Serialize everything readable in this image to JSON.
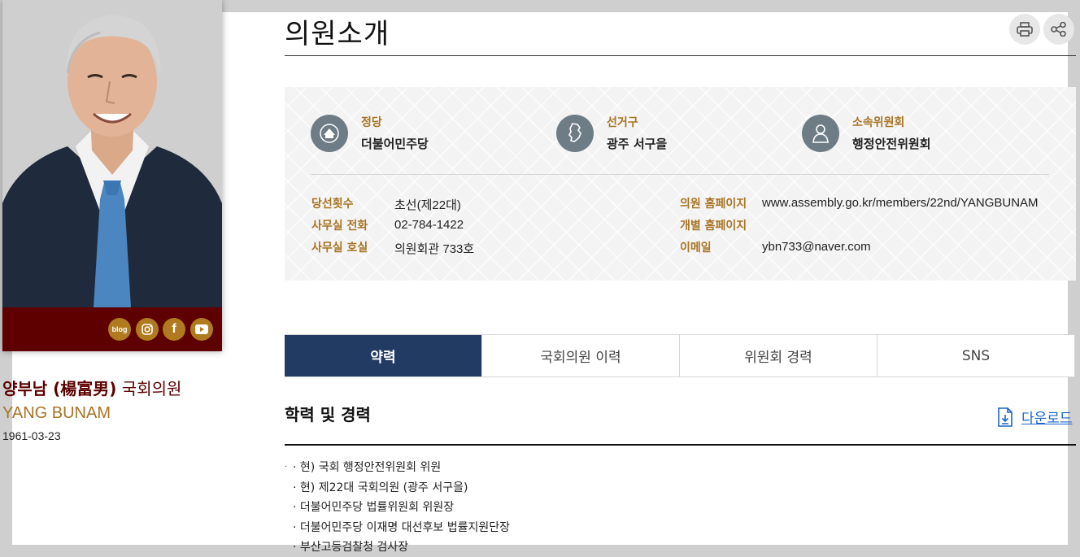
{
  "page": {
    "title": "의원소개"
  },
  "toolbar": {
    "print_icon": "printer-icon",
    "share_icon": "share-icon"
  },
  "profile": {
    "name_ko": "양부남 (楊富男)",
    "name_suffix": " 국회의원",
    "name_en": "YANG BUNAM",
    "birth": "1961-03-23",
    "sns": {
      "blog_label": "blog",
      "instagram_icon": "instagram-icon",
      "facebook_label": "f",
      "youtube_icon": "youtube-icon"
    }
  },
  "summary": {
    "party_label": "정당",
    "party_value": "더불어민주당",
    "district_label": "선거구",
    "district_value": "광주 서구을",
    "committee_label": "소속위원회",
    "committee_value": "행정안전위원회"
  },
  "details": {
    "terms_label": "당선횟수",
    "terms_value": "초선(제22대)",
    "phone_label": "사무실 전화",
    "phone_value": "02-784-1422",
    "office_label": "사무실 호실",
    "office_value": "의원회관 733호",
    "homepage_label": "의원 홈페이지",
    "homepage_value": "www.assembly.go.kr/members/22nd/YANGBUNAM",
    "personal_homepage_label": "개별 홈페이지",
    "personal_homepage_value": "",
    "email_label": "이메일",
    "email_value": "ybn733@naver.com"
  },
  "tabs": [
    {
      "label": "약력",
      "active": true
    },
    {
      "label": "국회의원 이력",
      "active": false
    },
    {
      "label": "위원회 경력",
      "active": false
    },
    {
      "label": "SNS",
      "active": false
    }
  ],
  "section": {
    "title": "학력 및 경력",
    "download_label": "다운로드"
  },
  "career": [
    "· 현) 국회 행정안전위원회 위원",
    "· 현) 제22대 국회의원 (광주 서구을)",
    "· 더불어민주당 법률위원회 위원장",
    "· 더불어민주당 이재명 대선후보 법률지원단장",
    "· 부산고등검찰청 검사장"
  ],
  "colors": {
    "accent_gold": "#a87424",
    "maroon": "#5e0000",
    "tab_active": "#223b63",
    "link_blue": "#1b66c9"
  }
}
